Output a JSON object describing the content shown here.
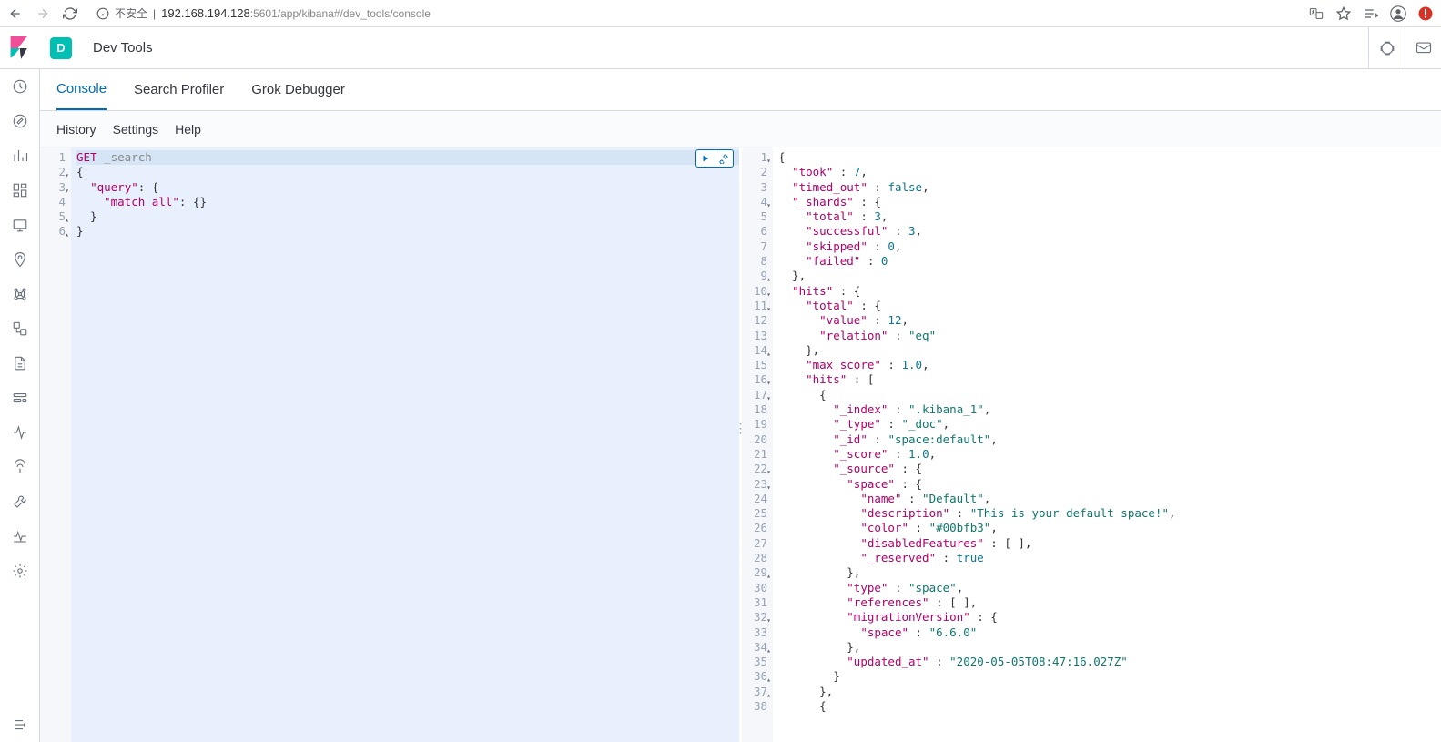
{
  "browser": {
    "security_label": "不安全",
    "url_host": "192.168.194.128",
    "url_port": ":5601",
    "url_path": "/app/kibana#/dev_tools/console"
  },
  "header": {
    "space_initial": "D",
    "title": "Dev Tools"
  },
  "tabs": [
    "Console",
    "Search Profiler",
    "Grok Debugger"
  ],
  "subbar": [
    "History",
    "Settings",
    "Help"
  ],
  "request": {
    "method": "GET",
    "endpoint": "_search",
    "body_lines": [
      {
        "n": 1,
        "fold": ""
      },
      {
        "n": 2,
        "fold": "▾",
        "txt": "{"
      },
      {
        "n": 3,
        "fold": "▾",
        "txt": "  \"query\": {"
      },
      {
        "n": 4,
        "fold": "",
        "txt": "    \"match_all\": {}"
      },
      {
        "n": 5,
        "fold": "▴",
        "txt": "  }"
      },
      {
        "n": 6,
        "fold": "▴",
        "txt": "}"
      }
    ]
  },
  "response_lines": [
    {
      "n": 1,
      "fold": "▾",
      "html": "{"
    },
    {
      "n": 2,
      "fold": "",
      "html": "  <span class='k-key'>\"took\"</span> : <span class='k-num'>7</span>,"
    },
    {
      "n": 3,
      "fold": "",
      "html": "  <span class='k-key'>\"timed_out\"</span> : <span class='k-bool'>false</span>,"
    },
    {
      "n": 4,
      "fold": "▾",
      "html": "  <span class='k-key'>\"_shards\"</span> : {"
    },
    {
      "n": 5,
      "fold": "",
      "html": "    <span class='k-key'>\"total\"</span> : <span class='k-num'>3</span>,"
    },
    {
      "n": 6,
      "fold": "",
      "html": "    <span class='k-key'>\"successful\"</span> : <span class='k-num'>3</span>,"
    },
    {
      "n": 7,
      "fold": "",
      "html": "    <span class='k-key'>\"skipped\"</span> : <span class='k-num'>0</span>,"
    },
    {
      "n": 8,
      "fold": "",
      "html": "    <span class='k-key'>\"failed\"</span> : <span class='k-num'>0</span>"
    },
    {
      "n": 9,
      "fold": "▴",
      "html": "  },"
    },
    {
      "n": 10,
      "fold": "▾",
      "html": "  <span class='k-key'>\"hits\"</span> : {"
    },
    {
      "n": 11,
      "fold": "▾",
      "html": "    <span class='k-key'>\"total\"</span> : {"
    },
    {
      "n": 12,
      "fold": "",
      "html": "      <span class='k-key'>\"value\"</span> : <span class='k-num'>12</span>,"
    },
    {
      "n": 13,
      "fold": "",
      "html": "      <span class='k-key'>\"relation\"</span> : <span class='k-str'>\"eq\"</span>"
    },
    {
      "n": 14,
      "fold": "▴",
      "html": "    },"
    },
    {
      "n": 15,
      "fold": "",
      "html": "    <span class='k-key'>\"max_score\"</span> : <span class='k-num'>1.0</span>,"
    },
    {
      "n": 16,
      "fold": "▾",
      "html": "    <span class='k-key'>\"hits\"</span> : ["
    },
    {
      "n": 17,
      "fold": "▾",
      "html": "      {"
    },
    {
      "n": 18,
      "fold": "",
      "html": "        <span class='k-key'>\"_index\"</span> : <span class='k-str'>\".kibana_1\"</span>,"
    },
    {
      "n": 19,
      "fold": "",
      "html": "        <span class='k-key'>\"_type\"</span> : <span class='k-str'>\"_doc\"</span>,"
    },
    {
      "n": 20,
      "fold": "",
      "html": "        <span class='k-key'>\"_id\"</span> : <span class='k-str'>\"space:default\"</span>,"
    },
    {
      "n": 21,
      "fold": "",
      "html": "        <span class='k-key'>\"_score\"</span> : <span class='k-num'>1.0</span>,"
    },
    {
      "n": 22,
      "fold": "▾",
      "html": "        <span class='k-key'>\"_source\"</span> : {"
    },
    {
      "n": 23,
      "fold": "▾",
      "html": "          <span class='k-key'>\"space\"</span> : {"
    },
    {
      "n": 24,
      "fold": "",
      "html": "            <span class='k-key'>\"name\"</span> : <span class='k-str'>\"Default\"</span>,"
    },
    {
      "n": 25,
      "fold": "",
      "html": "            <span class='k-key'>\"description\"</span> : <span class='k-str'>\"This is your default space!\"</span>,"
    },
    {
      "n": 26,
      "fold": "",
      "html": "            <span class='k-key'>\"color\"</span> : <span class='k-str'>\"#00bfb3\"</span>,"
    },
    {
      "n": 27,
      "fold": "",
      "html": "            <span class='k-key'>\"disabledFeatures\"</span> : [ ],"
    },
    {
      "n": 28,
      "fold": "",
      "html": "            <span class='k-key'>\"_reserved\"</span> : <span class='k-bool'>true</span>"
    },
    {
      "n": 29,
      "fold": "▴",
      "html": "          },"
    },
    {
      "n": 30,
      "fold": "",
      "html": "          <span class='k-key'>\"type\"</span> : <span class='k-str'>\"space\"</span>,"
    },
    {
      "n": 31,
      "fold": "",
      "html": "          <span class='k-key'>\"references\"</span> : [ ],"
    },
    {
      "n": 32,
      "fold": "▾",
      "html": "          <span class='k-key'>\"migrationVersion\"</span> : {"
    },
    {
      "n": 33,
      "fold": "",
      "html": "            <span class='k-key'>\"space\"</span> : <span class='k-str'>\"6.6.0\"</span>"
    },
    {
      "n": 34,
      "fold": "▴",
      "html": "          },"
    },
    {
      "n": 35,
      "fold": "",
      "html": "          <span class='k-key'>\"updated_at\"</span> : <span class='k-str'>\"2020-05-05T08:47:16.027Z\"</span>"
    },
    {
      "n": 36,
      "fold": "▴",
      "html": "        }"
    },
    {
      "n": 37,
      "fold": "▴",
      "html": "      },"
    },
    {
      "n": 38,
      "fold": "",
      "html": "      {"
    }
  ]
}
